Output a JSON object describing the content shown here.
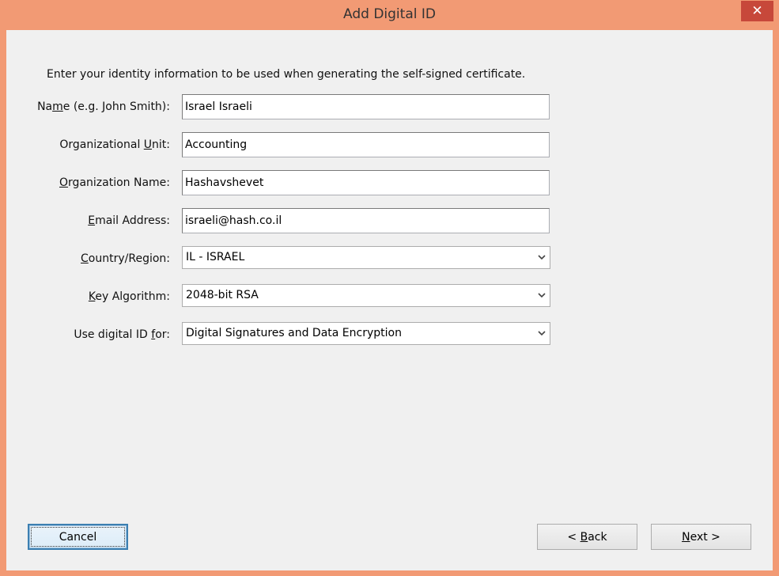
{
  "window": {
    "title": "Add Digital ID",
    "close_glyph": "✕"
  },
  "form": {
    "intro": "Enter your identity information to be used when generating the self-signed certificate.",
    "name": {
      "label_pre": "Na",
      "label_ul": "m",
      "label_post": "e (e.g. John Smith):",
      "value": "Israel Israeli"
    },
    "org_unit": {
      "label_pre": "Organizational ",
      "label_ul": "U",
      "label_post": "nit:",
      "value": "Accounting"
    },
    "org_name": {
      "label_pre": "",
      "label_ul": "O",
      "label_post": "rganization Name:",
      "value": "Hashavshevet"
    },
    "email": {
      "label_pre": "",
      "label_ul": "E",
      "label_post": "mail Address:",
      "value": "israeli@hash.co.il"
    },
    "country": {
      "label_pre": "",
      "label_ul": "C",
      "label_post": "ountry/Region:",
      "value": "IL - ISRAEL"
    },
    "key_algorithm": {
      "label_pre": "",
      "label_ul": "K",
      "label_post": "ey Algorithm:",
      "value": "2048-bit RSA"
    },
    "use_for": {
      "label_pre": "Use digital ID ",
      "label_ul": "f",
      "label_post": "or:",
      "value": "Digital Signatures and Data Encryption"
    }
  },
  "buttons": {
    "cancel": "Cancel",
    "back_pre": "< ",
    "back_ul": "B",
    "back_post": "ack",
    "next_ul": "N",
    "next_post": "ext >"
  }
}
